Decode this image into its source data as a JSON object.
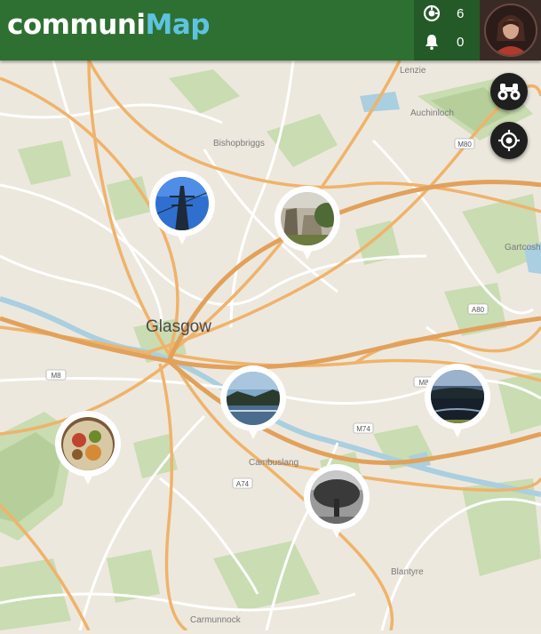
{
  "header": {
    "logo_part1": "communi",
    "logo_part2": "Map",
    "logo_color_primary": "#ffffff",
    "logo_color_accent": "#5ec3e0",
    "bar_color": "#2e7032",
    "counter_contributions": "6",
    "counter_notifications": "0"
  },
  "map": {
    "city_label": "Glasgow",
    "place_labels": [
      "Lenzie",
      "Auchinloch",
      "Bishopbriggs",
      "Cambuslang",
      "Carmunnock",
      "Blantyre",
      "Gartcosh"
    ],
    "road_shields": [
      "M80",
      "A80",
      "M8",
      "M8",
      "M74",
      "A74"
    ],
    "controls": [
      "binoculars-icon",
      "locate-icon"
    ]
  },
  "pins": [
    {
      "name": "photo-pin-pylon",
      "subject": "electricity pylon against blue sky"
    },
    {
      "name": "photo-pin-ruins",
      "subject": "old stone building and trees"
    },
    {
      "name": "photo-pin-river",
      "subject": "river reflecting sky and trees"
    },
    {
      "name": "photo-pin-loch",
      "subject": "loch with dark water"
    },
    {
      "name": "photo-pin-food",
      "subject": "plate of food"
    },
    {
      "name": "photo-pin-tree",
      "subject": "black and white tree"
    }
  ]
}
